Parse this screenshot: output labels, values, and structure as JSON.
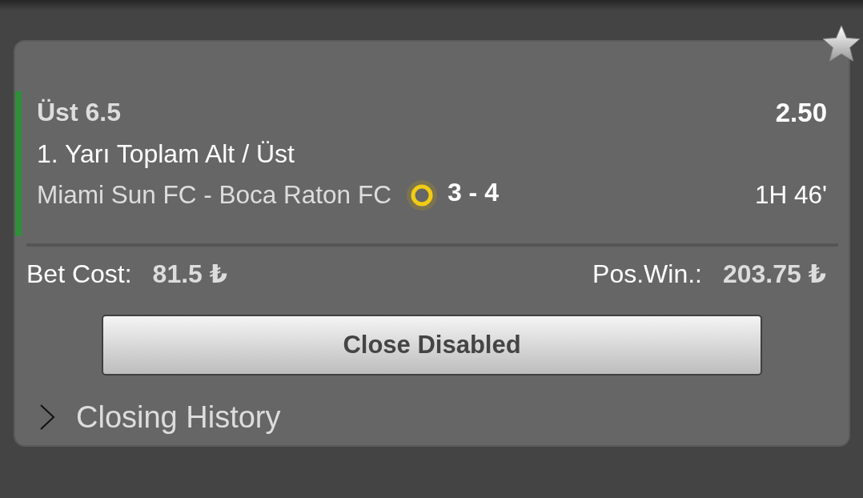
{
  "selection": {
    "pick": "Üst 6.5",
    "odds": "2.50",
    "market": "1. Yarı Toplam Alt / Üst",
    "match": "Miami Sun FC - Boca Raton FC",
    "live": true,
    "score": "3 - 4",
    "match_time": "1H 46'"
  },
  "summary": [
    {
      "label": "Bet Cost:",
      "value": "81.5 ₺"
    },
    {
      "label": "Pos.Win.:",
      "value": "203.75 ₺"
    }
  ],
  "close_button": {
    "label": "Close Disabled"
  },
  "closing_history": {
    "label": "Closing History",
    "expanded": false
  }
}
